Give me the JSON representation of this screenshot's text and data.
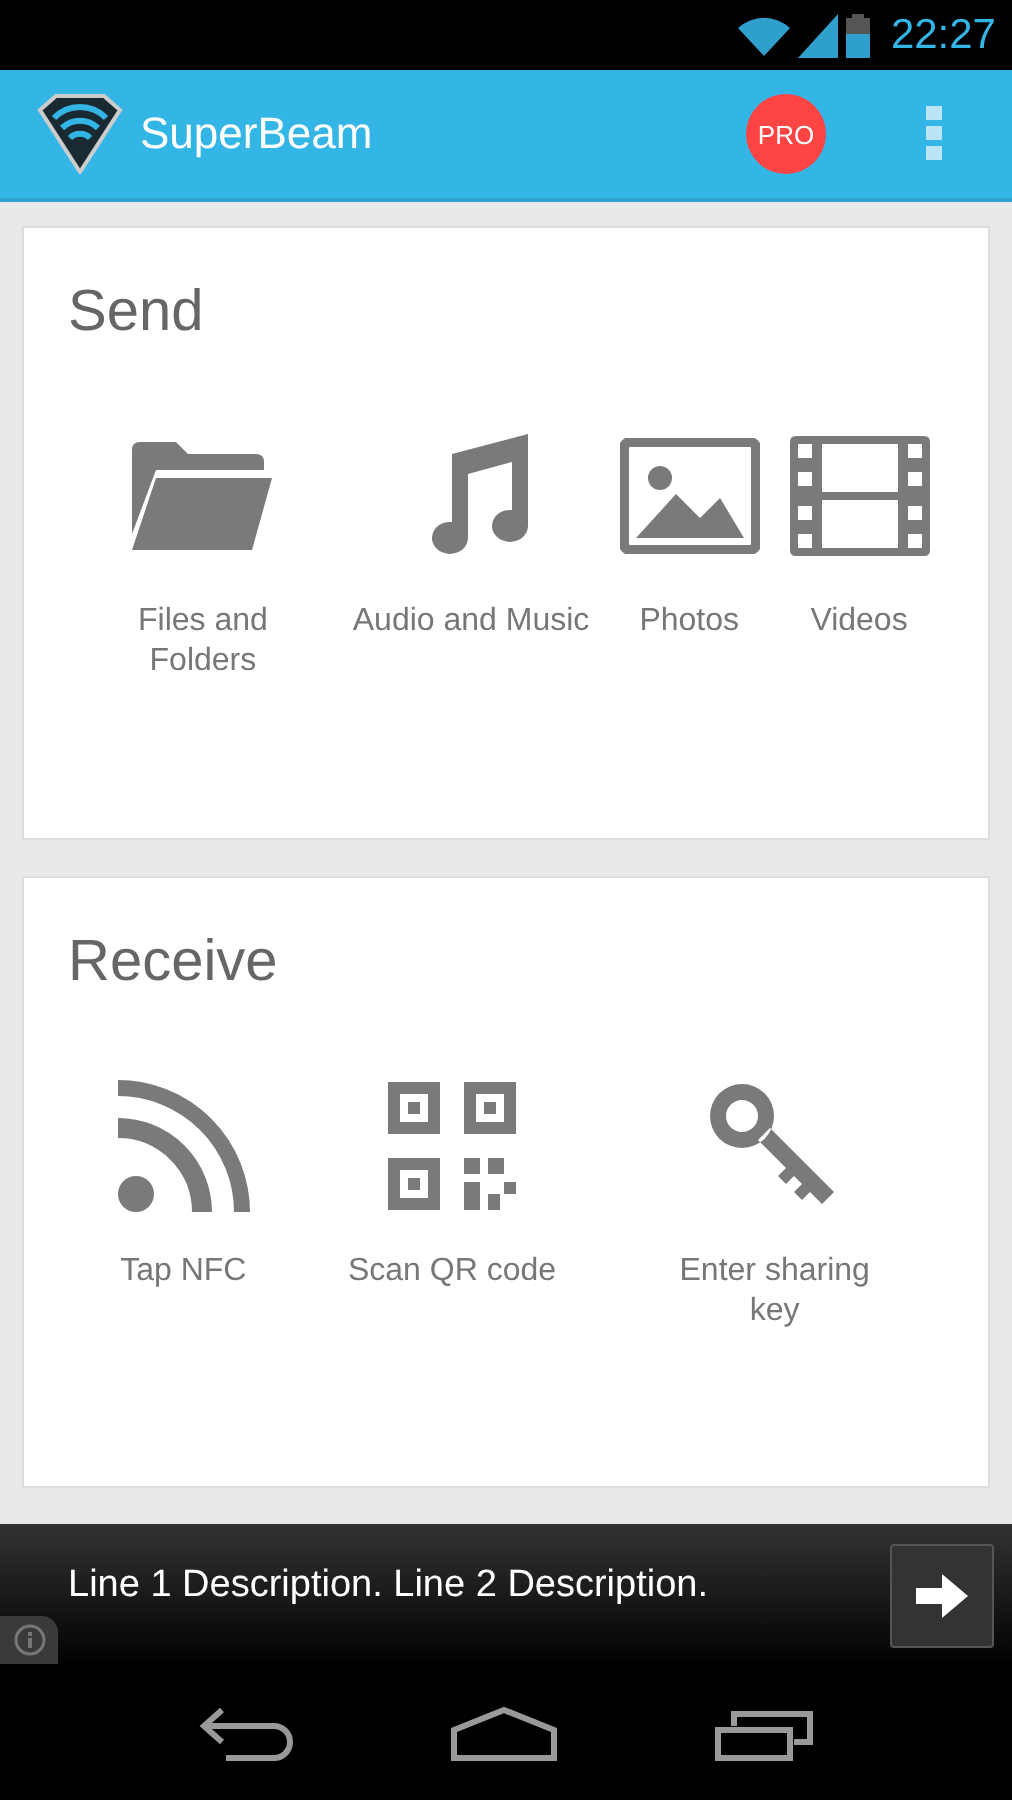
{
  "status_bar": {
    "time": "22:27"
  },
  "app_bar": {
    "title": "SuperBeam",
    "badge": "PRO"
  },
  "send": {
    "title": "Send",
    "items": [
      {
        "kind": "folder",
        "label": "Files and Folders"
      },
      {
        "kind": "music",
        "label": "Audio and Music"
      },
      {
        "kind": "photo",
        "label": "Photos"
      },
      {
        "kind": "video",
        "label": "Videos"
      }
    ]
  },
  "receive": {
    "title": "Receive",
    "items": [
      {
        "kind": "nfc",
        "label": "Tap NFC"
      },
      {
        "kind": "qr",
        "label": "Scan QR code"
      },
      {
        "kind": "key",
        "label": "Enter sharing key"
      }
    ]
  },
  "ad": {
    "text": "Line 1 Description. Line 2 Description."
  }
}
